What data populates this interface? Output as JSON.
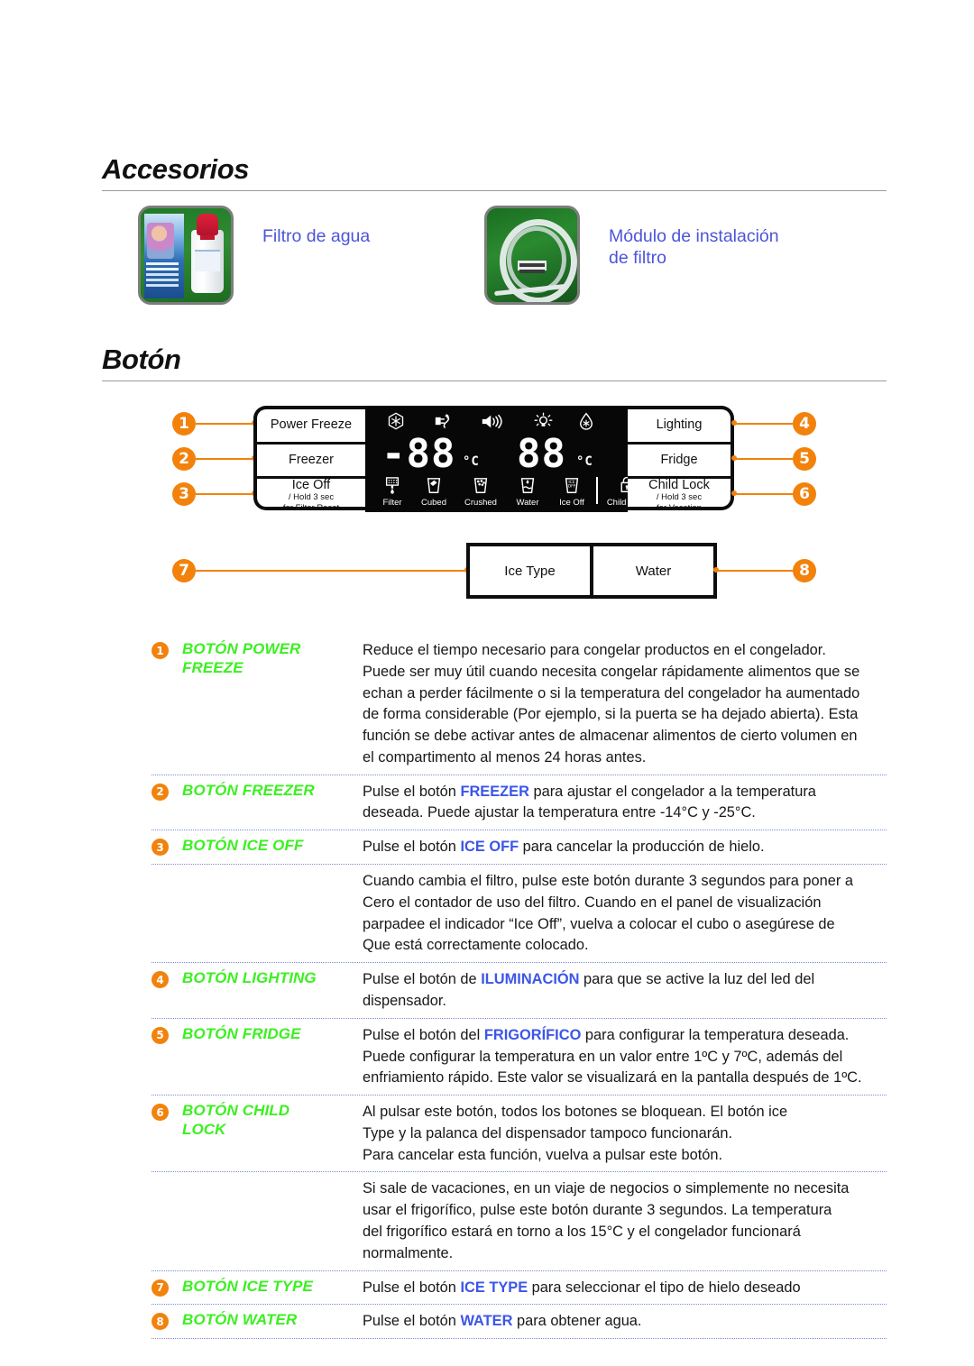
{
  "sections": {
    "accesorios_title": "Accesorios",
    "boton_title": "Botón"
  },
  "accessories": [
    {
      "label": "Filtro de agua",
      "image": "water-filter-box-photo"
    },
    {
      "label": "Módulo de instalación\nde filtro",
      "label_line1": "Módulo de instalación",
      "label_line2": "de filtro",
      "image": "filter-install-kit-photo"
    }
  ],
  "panel": {
    "callouts": [
      "1",
      "2",
      "3",
      "4",
      "5",
      "6",
      "7",
      "8"
    ],
    "left_buttons": [
      {
        "name": "Power Freeze",
        "sub": ""
      },
      {
        "name": "Freezer",
        "sub": ""
      },
      {
        "name": "Ice Off",
        "sub_line1": "/ Hold 3 sec",
        "sub_line2": "for Filter Reset"
      }
    ],
    "right_buttons": [
      {
        "name": "Lighting",
        "sub": ""
      },
      {
        "name": "Fridge",
        "sub": ""
      },
      {
        "name": "Child Lock",
        "sub_line1": "/ Hold 3 sec",
        "sub_line2": "for Vacation"
      }
    ],
    "bottom_buttons": [
      "Ice Type",
      "Water"
    ],
    "display": {
      "top_icons": [
        "power-freeze-snowflake-icon",
        "energy-saver-plug-icon",
        "alarm-speaker-icon",
        "lighting-bulb-icon",
        "power-cool-droplet-icon"
      ],
      "freezer_value": "-88",
      "freezer_unit": "°C",
      "fridge_value": "88",
      "fridge_unit": "°C",
      "indicators": [
        {
          "icon": "filter-shower-icon",
          "label": "Filter"
        },
        {
          "icon": "cubed-ice-glass-icon",
          "label": "Cubed"
        },
        {
          "icon": "crushed-ice-glass-icon",
          "label": "Crushed"
        },
        {
          "icon": "water-glass-icon",
          "label": "Water"
        },
        {
          "icon": "ice-off-glass-icon",
          "label": "Ice Off"
        },
        {
          "icon": "padlock-icon",
          "label": "Child Lock"
        }
      ]
    }
  },
  "rows": [
    {
      "num": "1",
      "label_line1": "BOTÓN POWER",
      "label_line2": "FREEZE",
      "lines": [
        [
          {
            "t": "Reduce el tiempo necesario para congelar productos en el congelador."
          }
        ],
        [
          {
            "t": "Puede ser muy útil cuando necesita congelar rápidamente alimentos que se"
          }
        ],
        [
          {
            "t": "echan a perder fácilmente o si la temperatura del congelador ha aumentado"
          }
        ],
        [
          {
            "t": "de forma considerable (Por ejemplo, si la puerta se ha dejado abierta). Esta"
          }
        ],
        [
          {
            "t": "función se debe activar antes de almacenar alimentos de cierto volumen en"
          }
        ],
        [
          {
            "t": "el compartimento al menos 24 horas antes."
          }
        ]
      ]
    },
    {
      "num": "2",
      "label_line1": "BOTÓN FREEZER",
      "label_line2": "",
      "lines": [
        [
          {
            "t": "Pulse el botón "
          },
          {
            "t": "FREEZER",
            "hl": true
          },
          {
            "t": " para ajustar el congelador a la temperatura"
          }
        ],
        [
          {
            "t": "deseada. Puede ajustar la temperatura entre -14°C y -25°C."
          }
        ]
      ]
    },
    {
      "num": "3",
      "label_line1": "BOTÓN ICE OFF",
      "label_line2": "",
      "lines": [
        [
          {
            "t": "Pulse el botón "
          },
          {
            "t": "ICE OFF",
            "hl": true
          },
          {
            "t": " para cancelar la producción de hielo."
          }
        ]
      ]
    },
    {
      "num": "",
      "label_line1": "",
      "label_line2": "",
      "indent": true,
      "lines": [
        [
          {
            "t": "Cuando cambia el filtro, pulse este botón durante 3 segundos para poner a"
          }
        ],
        [
          {
            "t": "Cero el contador de uso del filtro. Cuando en el panel de visualización"
          }
        ],
        [
          {
            "t": "parpadee el indicador “Ice Off”, vuelva a colocar el cubo o asegúrese de"
          }
        ],
        [
          {
            "t": "Que está correctamente colocado."
          }
        ]
      ]
    },
    {
      "num": "4",
      "label_line1": "BOTÓN LIGHTING",
      "label_line2": "",
      "lines": [
        [
          {
            "t": "Pulse el botón de "
          },
          {
            "t": "ILUMINACIÓN",
            "hl": true
          },
          {
            "t": " para que se active la luz del led del"
          }
        ],
        [
          {
            "t": "dispensador."
          }
        ]
      ]
    },
    {
      "num": "5",
      "label_line1": "BOTÓN FRIDGE",
      "label_line2": "",
      "lines": [
        [
          {
            "t": "Pulse el botón del "
          },
          {
            "t": "FRIGORÍFICO",
            "hl": true
          },
          {
            "t": " para configurar la temperatura deseada."
          }
        ],
        [
          {
            "t": "Puede configurar la temperatura en un valor entre 1ºC y 7ºC, además del"
          }
        ],
        [
          {
            "t": "enfriamiento rápido. Este valor se visualizará en la pantalla después de 1ºC."
          }
        ]
      ]
    },
    {
      "num": "6",
      "label_line1": "BOTÓN CHILD",
      "label_line2": "LOCK",
      "lines": [
        [
          {
            "t": "Al pulsar este botón, todos los botones se bloquean. El botón ice"
          }
        ],
        [
          {
            "t": "Type y la palanca del dispensador tampoco funcionarán."
          }
        ],
        [
          {
            "t": "Para cancelar esta función, vuelva a pulsar este botón."
          }
        ]
      ]
    },
    {
      "num": "",
      "label_line1": "",
      "label_line2": "",
      "indent": true,
      "lines": [
        [
          {
            "t": "Si sale de vacaciones, en un viaje de negocios o simplemente no necesita"
          }
        ],
        [
          {
            "t": "usar el frigorífico, pulse este botón durante 3 segundos. La temperatura"
          }
        ],
        [
          {
            "t": "del frigorífico estará en torno a los 15°C y el congelador funcionará"
          }
        ],
        [
          {
            "t": "normalmente."
          }
        ]
      ]
    },
    {
      "num": "7",
      "label_line1": "BOTÓN ICE TYPE",
      "label_line2": "",
      "lines": [
        [
          {
            "t": "Pulse el botón "
          },
          {
            "t": "ICE TYPE",
            "hl": true
          },
          {
            "t": " para seleccionar el tipo de hielo deseado"
          }
        ]
      ]
    },
    {
      "num": "8",
      "label_line1": "BOTÓN WATER",
      "label_line2": "",
      "lines": [
        [
          {
            "t": "Pulse el botón "
          },
          {
            "t": "WATER",
            "hl": true
          },
          {
            "t": " para obtener agua."
          }
        ]
      ]
    }
  ],
  "colors": {
    "accent_orange": "#f2820b",
    "label_green": "#3bf020",
    "highlight_blue": "#3c56e8",
    "accessory_blue": "#4c55d8",
    "rule_gray": "#9a9a9a"
  }
}
